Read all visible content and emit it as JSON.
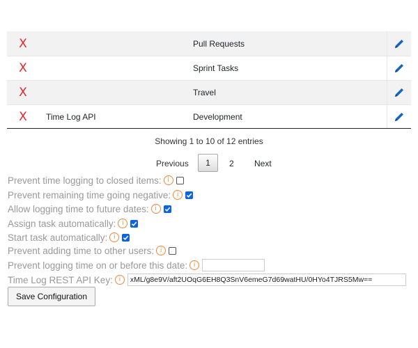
{
  "table": {
    "rows": [
      {
        "delete": "X",
        "name": "",
        "category": "Pull Requests"
      },
      {
        "delete": "X",
        "name": "",
        "category": "Sprint Tasks"
      },
      {
        "delete": "X",
        "name": "",
        "category": "Travel"
      },
      {
        "delete": "X",
        "name": "Time Log API",
        "category": "Development"
      }
    ],
    "info": "Showing 1 to 10 of 12 entries"
  },
  "pagination": {
    "previous": "Previous",
    "pages": [
      "1",
      "2"
    ],
    "next": "Next"
  },
  "settings": [
    {
      "label": "Prevent time logging to closed items:",
      "checked": false
    },
    {
      "label": "Prevent remaining time going negative:",
      "checked": true
    },
    {
      "label": "Allow logging time to future dates:",
      "checked": true
    },
    {
      "label": "Assign task automatically:",
      "checked": true
    },
    {
      "label": "Start task automatically:",
      "checked": true
    },
    {
      "label": "Prevent adding time to other users:",
      "checked": false
    }
  ],
  "date_setting": {
    "label": "Prevent logging time on or before this date:",
    "value": ""
  },
  "api_key_setting": {
    "label": "Time Log REST API Key:",
    "value": "xML/g8e9V/aft2UOqG6EH8Q3SnV6emeG7d69watHU/0HYo4TJRS5Mw=="
  },
  "info_icon": "i",
  "save_button": "Save Configuration",
  "colors": {
    "delete": "#e4232b",
    "edit": "#1565c0",
    "checkbox": "#0b62e3",
    "info_icon": "#f0883a"
  }
}
